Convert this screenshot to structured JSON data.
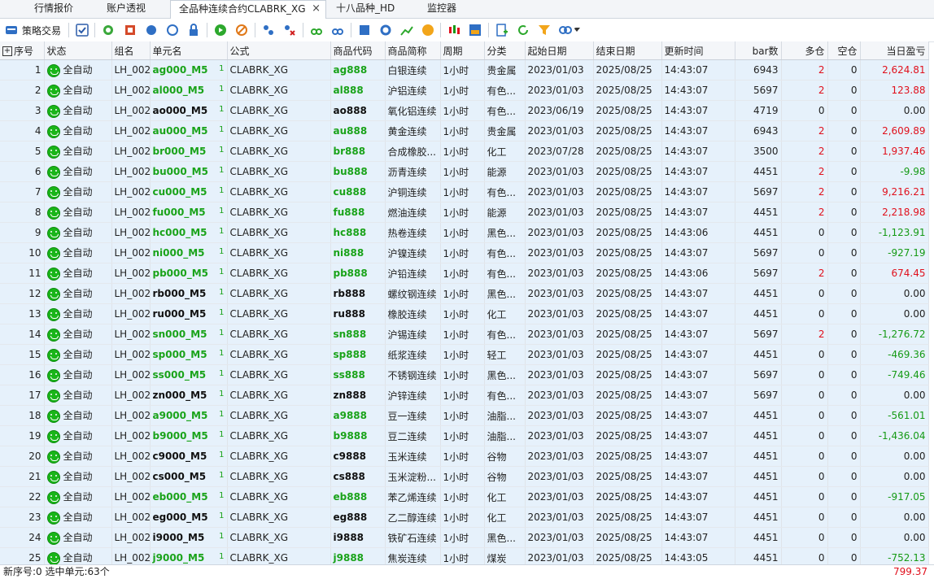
{
  "tabs": [
    {
      "label": "行情报价"
    },
    {
      "label": "账户透视"
    },
    {
      "label": "全品种连续合约CLABRK_XG",
      "active": true
    },
    {
      "label": "十八品种_HD"
    },
    {
      "label": "监控器"
    }
  ],
  "tab_close": "×",
  "toolbar": {
    "strategy_label": "策略交易"
  },
  "columns": [
    "序号",
    "状态",
    "组名",
    "单元名",
    "公式",
    "商品代码",
    "商品简称",
    "周期",
    "分类",
    "起始日期",
    "结束日期",
    "更新时间",
    "bar数",
    "多仓",
    "空仓",
    "当日盈亏"
  ],
  "rows": [
    {
      "n": "1",
      "status": "全自动",
      "group": "LH_002",
      "unit": "ag000_M5",
      "unit_green": true,
      "formula": "CLABRK_XG",
      "code": "ag888",
      "code_green": true,
      "name": "白银连续",
      "period": "1小时",
      "cat": "贵金属",
      "start": "2023/01/03",
      "end": "2025/08/25",
      "upd": "14:43:07",
      "bars": "6943",
      "long": "2",
      "short": "0",
      "pnl": "2,624.81",
      "pnl_sign": "pos"
    },
    {
      "n": "2",
      "status": "全自动",
      "group": "LH_002",
      "unit": "al000_M5",
      "unit_green": true,
      "formula": "CLABRK_XG",
      "code": "al888",
      "code_green": true,
      "name": "沪铝连续",
      "period": "1小时",
      "cat": "有色...",
      "start": "2023/01/03",
      "end": "2025/08/25",
      "upd": "14:43:07",
      "bars": "5697",
      "long": "2",
      "short": "0",
      "pnl": "123.88",
      "pnl_sign": "pos"
    },
    {
      "n": "3",
      "status": "全自动",
      "group": "LH_002",
      "unit": "ao000_M5",
      "unit_green": false,
      "formula": "CLABRK_XG",
      "code": "ao888",
      "code_green": false,
      "name": "氧化铝连续",
      "period": "1小时",
      "cat": "有色...",
      "start": "2023/06/19",
      "end": "2025/08/25",
      "upd": "14:43:07",
      "bars": "4719",
      "long": "0",
      "short": "0",
      "pnl": "0.00",
      "pnl_sign": "zero"
    },
    {
      "n": "4",
      "status": "全自动",
      "group": "LH_002",
      "unit": "au000_M5",
      "unit_green": true,
      "formula": "CLABRK_XG",
      "code": "au888",
      "code_green": true,
      "name": "黄金连续",
      "period": "1小时",
      "cat": "贵金属",
      "start": "2023/01/03",
      "end": "2025/08/25",
      "upd": "14:43:07",
      "bars": "6943",
      "long": "2",
      "short": "0",
      "pnl": "2,609.89",
      "pnl_sign": "pos"
    },
    {
      "n": "5",
      "status": "全自动",
      "group": "LH_002",
      "unit": "br000_M5",
      "unit_green": true,
      "formula": "CLABRK_XG",
      "code": "br888",
      "code_green": true,
      "name": "合成橡胶...",
      "period": "1小时",
      "cat": "化工",
      "start": "2023/07/28",
      "end": "2025/08/25",
      "upd": "14:43:07",
      "bars": "3500",
      "long": "2",
      "short": "0",
      "pnl": "1,937.46",
      "pnl_sign": "pos"
    },
    {
      "n": "6",
      "status": "全自动",
      "group": "LH_002",
      "unit": "bu000_M5",
      "unit_green": true,
      "formula": "CLABRK_XG",
      "code": "bu888",
      "code_green": true,
      "name": "沥青连续",
      "period": "1小时",
      "cat": "能源",
      "start": "2023/01/03",
      "end": "2025/08/25",
      "upd": "14:43:07",
      "bars": "4451",
      "long": "2",
      "short": "0",
      "pnl": "-9.98",
      "pnl_sign": "neg"
    },
    {
      "n": "7",
      "status": "全自动",
      "group": "LH_002",
      "unit": "cu000_M5",
      "unit_green": true,
      "formula": "CLABRK_XG",
      "code": "cu888",
      "code_green": true,
      "name": "沪铜连续",
      "period": "1小时",
      "cat": "有色...",
      "start": "2023/01/03",
      "end": "2025/08/25",
      "upd": "14:43:07",
      "bars": "5697",
      "long": "2",
      "short": "0",
      "pnl": "9,216.21",
      "pnl_sign": "pos"
    },
    {
      "n": "8",
      "status": "全自动",
      "group": "LH_002",
      "unit": "fu000_M5",
      "unit_green": true,
      "formula": "CLABRK_XG",
      "code": "fu888",
      "code_green": true,
      "name": "燃油连续",
      "period": "1小时",
      "cat": "能源",
      "start": "2023/01/03",
      "end": "2025/08/25",
      "upd": "14:43:07",
      "bars": "4451",
      "long": "2",
      "short": "0",
      "pnl": "2,218.98",
      "pnl_sign": "pos"
    },
    {
      "n": "9",
      "status": "全自动",
      "group": "LH_002",
      "unit": "hc000_M5",
      "unit_green": true,
      "formula": "CLABRK_XG",
      "code": "hc888",
      "code_green": true,
      "name": "热卷连续",
      "period": "1小时",
      "cat": "黑色...",
      "start": "2023/01/03",
      "end": "2025/08/25",
      "upd": "14:43:06",
      "bars": "4451",
      "long": "0",
      "short": "0",
      "pnl": "-1,123.91",
      "pnl_sign": "neg"
    },
    {
      "n": "10",
      "status": "全自动",
      "group": "LH_002",
      "unit": "ni000_M5",
      "unit_green": true,
      "formula": "CLABRK_XG",
      "code": "ni888",
      "code_green": true,
      "name": "沪镍连续",
      "period": "1小时",
      "cat": "有色...",
      "start": "2023/01/03",
      "end": "2025/08/25",
      "upd": "14:43:07",
      "bars": "5697",
      "long": "0",
      "short": "0",
      "pnl": "-927.19",
      "pnl_sign": "neg"
    },
    {
      "n": "11",
      "status": "全自动",
      "group": "LH_002",
      "unit": "pb000_M5",
      "unit_green": true,
      "formula": "CLABRK_XG",
      "code": "pb888",
      "code_green": true,
      "name": "沪铅连续",
      "period": "1小时",
      "cat": "有色...",
      "start": "2023/01/03",
      "end": "2025/08/25",
      "upd": "14:43:06",
      "bars": "5697",
      "long": "2",
      "short": "0",
      "pnl": "674.45",
      "pnl_sign": "pos"
    },
    {
      "n": "12",
      "status": "全自动",
      "group": "LH_002",
      "unit": "rb000_M5",
      "unit_green": false,
      "formula": "CLABRK_XG",
      "code": "rb888",
      "code_green": false,
      "name": "螺纹钢连续",
      "period": "1小时",
      "cat": "黑色...",
      "start": "2023/01/03",
      "end": "2025/08/25",
      "upd": "14:43:07",
      "bars": "4451",
      "long": "0",
      "short": "0",
      "pnl": "0.00",
      "pnl_sign": "zero"
    },
    {
      "n": "13",
      "status": "全自动",
      "group": "LH_002",
      "unit": "ru000_M5",
      "unit_green": false,
      "formula": "CLABRK_XG",
      "code": "ru888",
      "code_green": false,
      "name": "橡胶连续",
      "period": "1小时",
      "cat": "化工",
      "start": "2023/01/03",
      "end": "2025/08/25",
      "upd": "14:43:07",
      "bars": "4451",
      "long": "0",
      "short": "0",
      "pnl": "0.00",
      "pnl_sign": "zero"
    },
    {
      "n": "14",
      "status": "全自动",
      "group": "LH_002",
      "unit": "sn000_M5",
      "unit_green": true,
      "formula": "CLABRK_XG",
      "code": "sn888",
      "code_green": true,
      "name": "沪锡连续",
      "period": "1小时",
      "cat": "有色...",
      "start": "2023/01/03",
      "end": "2025/08/25",
      "upd": "14:43:07",
      "bars": "5697",
      "long": "2",
      "short": "0",
      "pnl": "-1,276.72",
      "pnl_sign": "neg"
    },
    {
      "n": "15",
      "status": "全自动",
      "group": "LH_002",
      "unit": "sp000_M5",
      "unit_green": true,
      "formula": "CLABRK_XG",
      "code": "sp888",
      "code_green": true,
      "name": "纸浆连续",
      "period": "1小时",
      "cat": "轻工",
      "start": "2023/01/03",
      "end": "2025/08/25",
      "upd": "14:43:07",
      "bars": "4451",
      "long": "0",
      "short": "0",
      "pnl": "-469.36",
      "pnl_sign": "neg"
    },
    {
      "n": "16",
      "status": "全自动",
      "group": "LH_002",
      "unit": "ss000_M5",
      "unit_green": true,
      "formula": "CLABRK_XG",
      "code": "ss888",
      "code_green": true,
      "name": "不锈钢连续",
      "period": "1小时",
      "cat": "黑色...",
      "start": "2023/01/03",
      "end": "2025/08/25",
      "upd": "14:43:07",
      "bars": "5697",
      "long": "0",
      "short": "0",
      "pnl": "-749.46",
      "pnl_sign": "neg"
    },
    {
      "n": "17",
      "status": "全自动",
      "group": "LH_002",
      "unit": "zn000_M5",
      "unit_green": false,
      "formula": "CLABRK_XG",
      "code": "zn888",
      "code_green": false,
      "name": "沪锌连续",
      "period": "1小时",
      "cat": "有色...",
      "start": "2023/01/03",
      "end": "2025/08/25",
      "upd": "14:43:07",
      "bars": "5697",
      "long": "0",
      "short": "0",
      "pnl": "0.00",
      "pnl_sign": "zero"
    },
    {
      "n": "18",
      "status": "全自动",
      "group": "LH_002",
      "unit": "a9000_M5",
      "unit_green": true,
      "formula": "CLABRK_XG",
      "code": "a9888",
      "code_green": true,
      "name": "豆一连续",
      "period": "1小时",
      "cat": "油脂...",
      "start": "2023/01/03",
      "end": "2025/08/25",
      "upd": "14:43:07",
      "bars": "4451",
      "long": "0",
      "short": "0",
      "pnl": "-561.01",
      "pnl_sign": "neg"
    },
    {
      "n": "19",
      "status": "全自动",
      "group": "LH_002",
      "unit": "b9000_M5",
      "unit_green": true,
      "formula": "CLABRK_XG",
      "code": "b9888",
      "code_green": true,
      "name": "豆二连续",
      "period": "1小时",
      "cat": "油脂...",
      "start": "2023/01/03",
      "end": "2025/08/25",
      "upd": "14:43:07",
      "bars": "4451",
      "long": "0",
      "short": "0",
      "pnl": "-1,436.04",
      "pnl_sign": "neg"
    },
    {
      "n": "20",
      "status": "全自动",
      "group": "LH_002",
      "unit": "c9000_M5",
      "unit_green": false,
      "formula": "CLABRK_XG",
      "code": "c9888",
      "code_green": false,
      "name": "玉米连续",
      "period": "1小时",
      "cat": "谷物",
      "start": "2023/01/03",
      "end": "2025/08/25",
      "upd": "14:43:07",
      "bars": "4451",
      "long": "0",
      "short": "0",
      "pnl": "0.00",
      "pnl_sign": "zero"
    },
    {
      "n": "21",
      "status": "全自动",
      "group": "LH_002",
      "unit": "cs000_M5",
      "unit_green": false,
      "formula": "CLABRK_XG",
      "code": "cs888",
      "code_green": false,
      "name": "玉米淀粉...",
      "period": "1小时",
      "cat": "谷物",
      "start": "2023/01/03",
      "end": "2025/08/25",
      "upd": "14:43:07",
      "bars": "4451",
      "long": "0",
      "short": "0",
      "pnl": "0.00",
      "pnl_sign": "zero"
    },
    {
      "n": "22",
      "status": "全自动",
      "group": "LH_002",
      "unit": "eb000_M5",
      "unit_green": true,
      "formula": "CLABRK_XG",
      "code": "eb888",
      "code_green": true,
      "name": "苯乙烯连续",
      "period": "1小时",
      "cat": "化工",
      "start": "2023/01/03",
      "end": "2025/08/25",
      "upd": "14:43:07",
      "bars": "4451",
      "long": "0",
      "short": "0",
      "pnl": "-917.05",
      "pnl_sign": "neg"
    },
    {
      "n": "23",
      "status": "全自动",
      "group": "LH_002",
      "unit": "eg000_M5",
      "unit_green": false,
      "formula": "CLABRK_XG",
      "code": "eg888",
      "code_green": false,
      "name": "乙二醇连续",
      "period": "1小时",
      "cat": "化工",
      "start": "2023/01/03",
      "end": "2025/08/25",
      "upd": "14:43:07",
      "bars": "4451",
      "long": "0",
      "short": "0",
      "pnl": "0.00",
      "pnl_sign": "zero"
    },
    {
      "n": "24",
      "status": "全自动",
      "group": "LH_002",
      "unit": "i9000_M5",
      "unit_green": false,
      "formula": "CLABRK_XG",
      "code": "i9888",
      "code_green": false,
      "name": "铁矿石连续",
      "period": "1小时",
      "cat": "黑色...",
      "start": "2023/01/03",
      "end": "2025/08/25",
      "upd": "14:43:07",
      "bars": "4451",
      "long": "0",
      "short": "0",
      "pnl": "0.00",
      "pnl_sign": "zero"
    },
    {
      "n": "25",
      "status": "全自动",
      "group": "LH_002",
      "unit": "j9000_M5",
      "unit_green": true,
      "formula": "CLABRK_XG",
      "code": "j9888",
      "code_green": true,
      "name": "焦炭连续",
      "period": "1小时",
      "cat": "煤炭",
      "start": "2023/01/03",
      "end": "2025/08/25",
      "upd": "14:43:05",
      "bars": "4451",
      "long": "0",
      "short": "0",
      "pnl": "-752.13",
      "pnl_sign": "neg"
    }
  ],
  "unit_suffix": "1",
  "statusbar": {
    "left": "新序号:0 选中单元:63个",
    "right": "799.37"
  },
  "colors": {
    "profit": "#e0101c",
    "loss": "#159a15",
    "row_bg": "#e6f1fb"
  }
}
